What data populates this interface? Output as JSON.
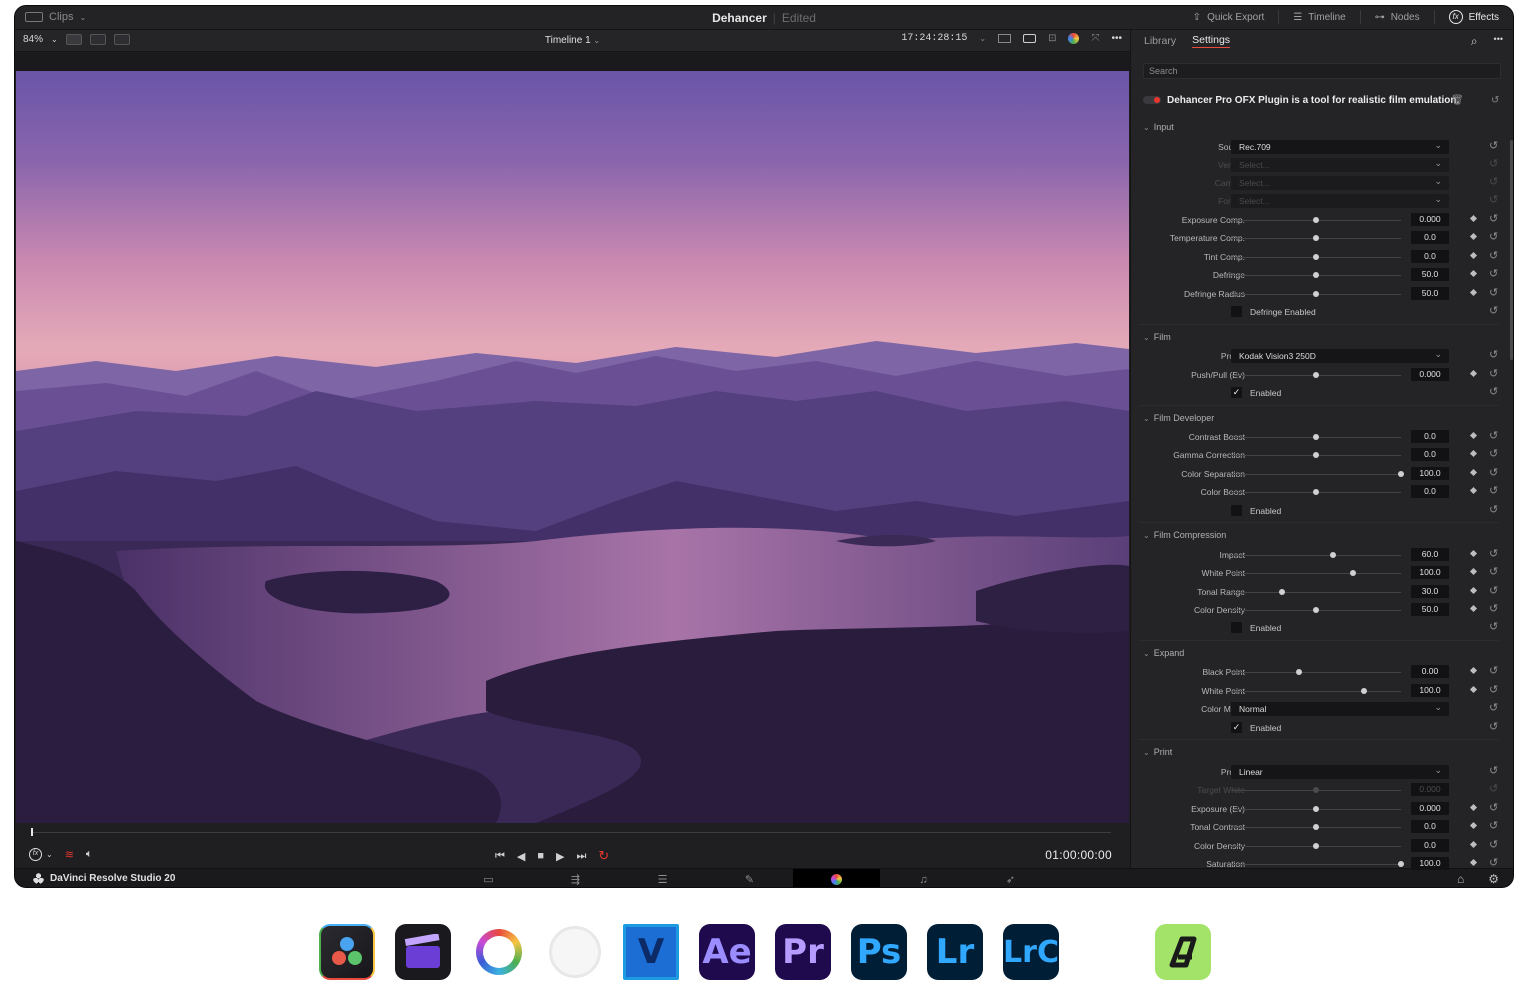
{
  "window": {
    "clips_label": "Clips",
    "app_title": "Dehancer",
    "status": "Edited",
    "quick_export": "Quick Export",
    "timeline": "Timeline",
    "nodes": "Nodes",
    "effects": "Effects"
  },
  "viewer_bar": {
    "zoom": "84%",
    "timeline_name": "Timeline 1",
    "timecode": "17:24:28:15"
  },
  "transport": {
    "timecode": "01:00:00:00"
  },
  "bottom_bar": {
    "brand": "DaVinci Resolve Studio 20"
  },
  "panel": {
    "tabs": [
      "Library",
      "Settings"
    ],
    "active_tab": "Settings",
    "search_placeholder": "Search",
    "plugin_title": "Dehancer Pro OFX Plugin is a tool for realistic film emulation.",
    "sections": {
      "input": "Input",
      "film": "Film",
      "film_developer": "Film Developer",
      "film_compression": "Film Compression",
      "expand": "Expand",
      "print": "Print"
    },
    "input": {
      "source_label": "Source",
      "source_value": "Rec.709",
      "vendor_label": "Vendor",
      "vendor_value": "Select...",
      "camera_label": "Camera",
      "camera_value": "Select...",
      "format_label": "Format",
      "format_value": "Select...",
      "exposure_label": "Exposure Comp.",
      "exposure_value": "0.000",
      "exposure_pos": 0.5,
      "temperature_label": "Temperature Comp.",
      "temperature_value": "0.0",
      "temperature_pos": 0.5,
      "tint_label": "Tint Comp.",
      "tint_value": "0.0",
      "tint_pos": 0.5,
      "defringe_label": "Defringe",
      "defringe_value": "50.0",
      "defringe_pos": 0.5,
      "defringe_radius_label": "Defringe Radius",
      "defringe_radius_value": "50.0",
      "defringe_radius_pos": 0.5,
      "defringe_enabled_label": "Defringe Enabled"
    },
    "film": {
      "profile_label": "Profile",
      "profile_value": "Kodak Vision3 250D",
      "push_label": "Push/Pull (Ev)",
      "push_value": "0.000",
      "push_pos": 0.5,
      "enabled_label": "Enabled"
    },
    "film_developer": {
      "contrast_label": "Contrast Boost",
      "contrast_value": "0.0",
      "contrast_pos": 0.5,
      "gamma_label": "Gamma Correction",
      "gamma_value": "0.0",
      "gamma_pos": 0.5,
      "separation_label": "Color Separation",
      "separation_value": "100.0",
      "separation_pos": 1.0,
      "boost_label": "Color Boost",
      "boost_value": "0.0",
      "boost_pos": 0.5,
      "enabled_label": "Enabled"
    },
    "film_compression": {
      "impact_label": "Impact",
      "impact_value": "60.0",
      "impact_pos": 0.6,
      "white_label": "White Point",
      "white_value": "100.0",
      "white_pos": 0.72,
      "tonal_label": "Tonal Range",
      "tonal_value": "30.0",
      "tonal_pos": 0.3,
      "density_label": "Color Density",
      "density_value": "50.0",
      "density_pos": 0.5,
      "enabled_label": "Enabled"
    },
    "expand": {
      "black_label": "Black Point",
      "black_value": "0.00",
      "black_pos": 0.4,
      "white_label": "White Point",
      "white_value": "100.0",
      "white_pos": 0.78,
      "mode_label": "Color Mode",
      "mode_value": "Normal",
      "enabled_label": "Enabled"
    },
    "print": {
      "profile_label": "Profile",
      "profile_value": "Linear",
      "target_label": "Target White",
      "target_value": "0.000",
      "target_pos": 0.5,
      "exposure_label": "Exposure (Ev)",
      "exposure_value": "0.000",
      "exposure_pos": 0.5,
      "contrast_label": "Tonal Contrast",
      "contrast_value": "0.0",
      "contrast_pos": 0.5,
      "density_label": "Color Density",
      "density_value": "0.0",
      "density_pos": 0.5,
      "saturation_label": "Saturation",
      "saturation_value": "100.0",
      "saturation_pos": 1.0
    }
  },
  "apps": [
    {
      "name": "davinci-resolve",
      "text": ""
    },
    {
      "name": "final-cut",
      "text": ""
    },
    {
      "name": "color-wheel",
      "text": ""
    },
    {
      "name": "white-circle",
      "text": ""
    },
    {
      "name": "vegas",
      "text": "V"
    },
    {
      "name": "after-effects",
      "text": "Ae"
    },
    {
      "name": "premiere-pro",
      "text": "Pr"
    },
    {
      "name": "photoshop",
      "text": "Ps"
    },
    {
      "name": "lightroom",
      "text": "Lr"
    },
    {
      "name": "lightroom-classic",
      "text": "LrC"
    },
    {
      "name": "affinity",
      "text": ""
    }
  ]
}
